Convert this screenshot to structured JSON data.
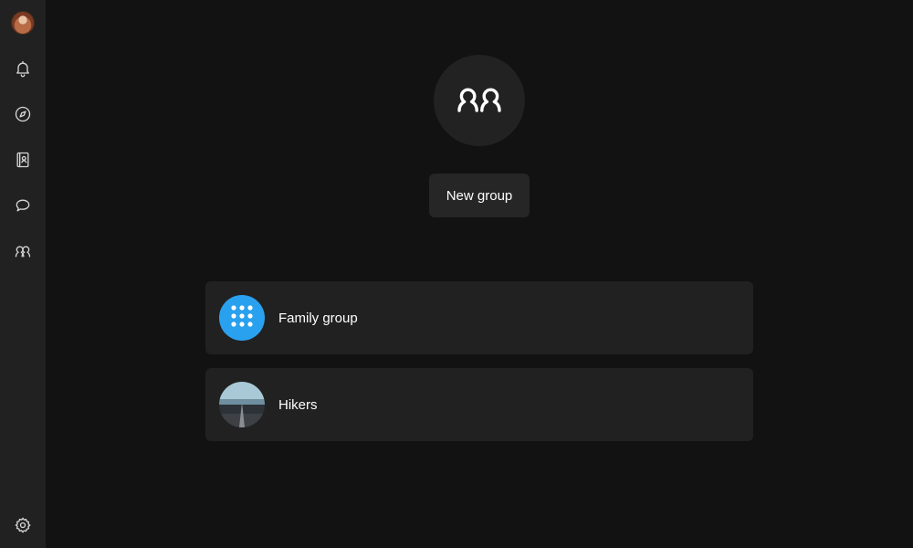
{
  "sidebar": {
    "items": [
      {
        "icon": "user-avatar",
        "label": ""
      },
      {
        "icon": "bell-icon"
      },
      {
        "icon": "compass-icon"
      },
      {
        "icon": "contacts-book-icon"
      },
      {
        "icon": "chat-bubble-icon"
      },
      {
        "icon": "groups-icon"
      }
    ],
    "footer_icon": "gear-icon"
  },
  "hero": {
    "icon": "groups-icon",
    "new_group_label": "New group"
  },
  "groups": [
    {
      "name": "Family group",
      "avatar": "dots-grid-icon",
      "avatar_color": "#2aa1ef"
    },
    {
      "name": "Hikers",
      "avatar": "landscape-photo"
    }
  ],
  "colors": {
    "background": "#121212",
    "sidebar": "#212121",
    "card": "#212121",
    "accent": "#2aa1ef",
    "text": "#ffffff"
  }
}
